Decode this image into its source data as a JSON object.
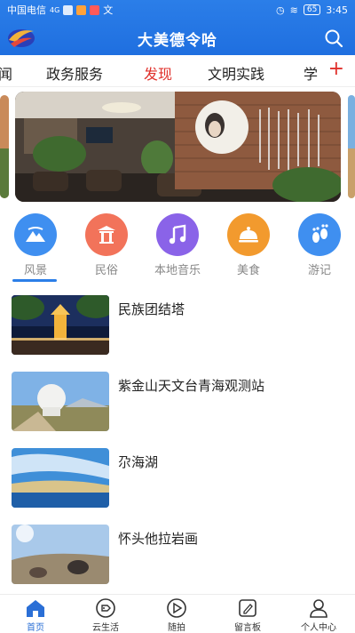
{
  "status_bar": {
    "carrier": "中国电信",
    "network": "4G",
    "extra": "文",
    "battery": "65",
    "time": "3:45"
  },
  "header": {
    "title": "大美德令哈",
    "logo_icon": "app-logo-icon",
    "search_icon": "search-icon"
  },
  "tabs": [
    {
      "label": "闻",
      "active": false
    },
    {
      "label": "政务服务",
      "active": false
    },
    {
      "label": "发现",
      "active": true
    },
    {
      "label": "文明实践",
      "active": false
    },
    {
      "label": "学",
      "active": false
    }
  ],
  "tab_add": "+",
  "categories": [
    {
      "label": "风景",
      "icon": "mountain-icon",
      "color": "#3f8ff0"
    },
    {
      "label": "民俗",
      "icon": "gate-icon",
      "color": "#f2735a"
    },
    {
      "label": "本地音乐",
      "icon": "music-note-icon",
      "color": "#8a63e8"
    },
    {
      "label": "美食",
      "icon": "food-cover-icon",
      "color": "#f29a2e"
    },
    {
      "label": "游记",
      "icon": "footprint-icon",
      "color": "#3f8ff0"
    }
  ],
  "articles": [
    {
      "title": "民族团结塔"
    },
    {
      "title": "紫金山天文台青海观测站"
    },
    {
      "title": "尕海湖"
    },
    {
      "title": "怀头他拉岩画"
    }
  ],
  "bottom_nav": [
    {
      "label": "首页",
      "icon": "home-icon",
      "active": true
    },
    {
      "label": "云生活",
      "icon": "tag-icon",
      "active": false
    },
    {
      "label": "随拍",
      "icon": "play-icon",
      "active": false
    },
    {
      "label": "留言板",
      "icon": "edit-icon",
      "active": false
    },
    {
      "label": "个人中心",
      "icon": "person-icon",
      "active": false
    }
  ],
  "colors": {
    "brand_blue": "#1f6fe0",
    "active_red": "#e0302b"
  }
}
